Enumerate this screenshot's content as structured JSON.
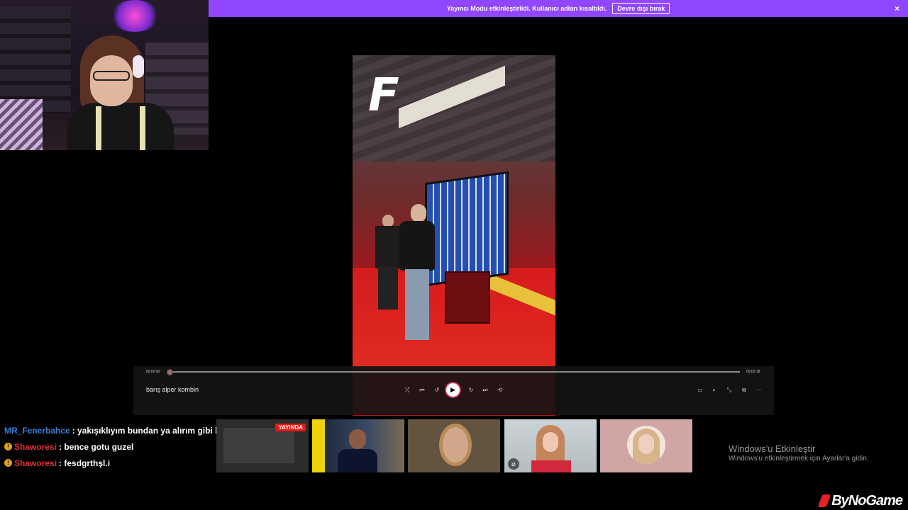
{
  "banner": {
    "text": "Yayıncı Modu etkinleştirildi. Kullanıcı adları kısaltıldı.",
    "button_label": "Devre dışı bırak",
    "close_icon": "×",
    "color": "#9146ff"
  },
  "player": {
    "time_current": "00:00:00",
    "time_total": "00:00:18",
    "progress": 0.0,
    "title": "barış alper kombin",
    "icons": {
      "shuffle": "⤮",
      "previous": "⏮",
      "rewind": "↺",
      "play": "▶",
      "forward": "↻",
      "next": "⏭",
      "repeat": "⟲",
      "subtitles": "▭",
      "volume": "◐",
      "fullscreen": "⤡",
      "miniplayer": "⧉",
      "more": "···"
    }
  },
  "chat": {
    "messages": [
      {
        "user": "MR_Fenerbahce",
        "text": ": yakışıklıyım bundan ya alırım gibi bunu",
        "badge": ""
      },
      {
        "user": "Shaworesi",
        "text": ": bence gotu guzel",
        "badge": "!"
      },
      {
        "user": "Shaworesi",
        "text": ": fesdgrthşl.i",
        "badge": "!"
      }
    ]
  },
  "thumbnails": {
    "live_badge": "YAYINDA",
    "mic_icon": "⌀"
  },
  "windows": {
    "line1": "Windows'u Etkinleştir",
    "line2": "Windows'u etkinleştirmek için Ayarlar'a gidin."
  },
  "watermark": {
    "text": "ByNoGame",
    "accent": "#e52327"
  },
  "video": {
    "logo": "F"
  }
}
